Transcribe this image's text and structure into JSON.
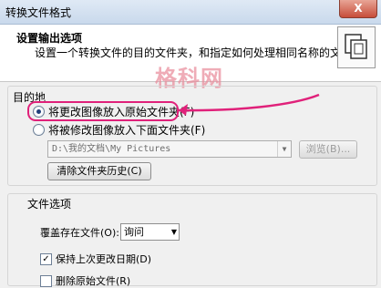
{
  "window": {
    "title": "转换文件格式",
    "close_glyph": "X"
  },
  "header": {
    "title": "设置输出选项",
    "description": "设置一个转换文件的目的文件夹，和指定如何处理相同名称的文件。",
    "icon": "copy-files-icon"
  },
  "watermark": "格科网",
  "destination": {
    "label": "目的地",
    "option_original": "将更改图像放入原始文件夹(F)",
    "option_below": "将被修改图像放入下面文件夹(F)",
    "selected": "original",
    "folder_path": "D:\\我的文档\\My Pictures",
    "browse_label": "浏览(B)...",
    "clear_history_label": "清除文件夹历史(C)"
  },
  "file_options": {
    "label": "文件选项",
    "overwrite_label": "覆盖存在文件(O):",
    "overwrite_value": "询问",
    "keep_date_label": "保持上次更改日期(D)",
    "keep_date_checked": true,
    "delete_original_label": "删除原始文件(R)",
    "delete_original_checked": false
  },
  "colors": {
    "highlight": "#e0217a",
    "watermark": "#e98a9a"
  }
}
